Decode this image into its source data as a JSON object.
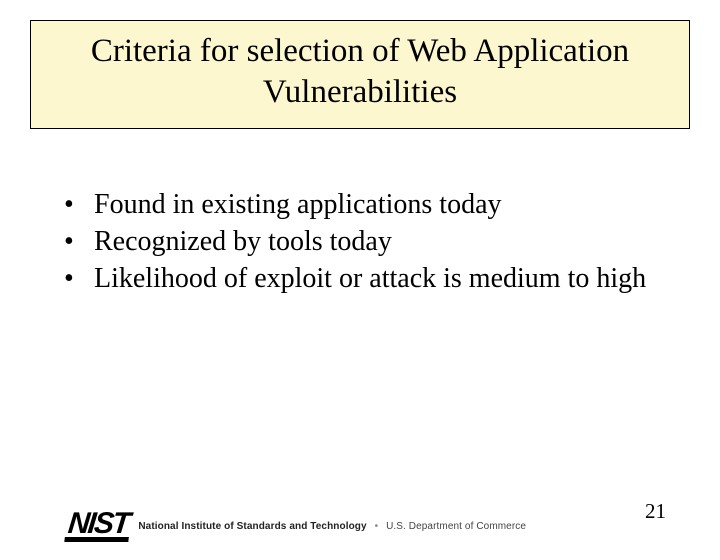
{
  "title": "Criteria for selection of Web Application Vulnerabilities",
  "bullets": [
    "Found in existing applications today",
    "Recognized by tools today",
    "Likelihood of exploit or attack is medium to high"
  ],
  "footer": {
    "mark": "NIST",
    "org": "National Institute of Standards and Technology",
    "dept": "U.S. Department of Commerce"
  },
  "page_number": "21"
}
